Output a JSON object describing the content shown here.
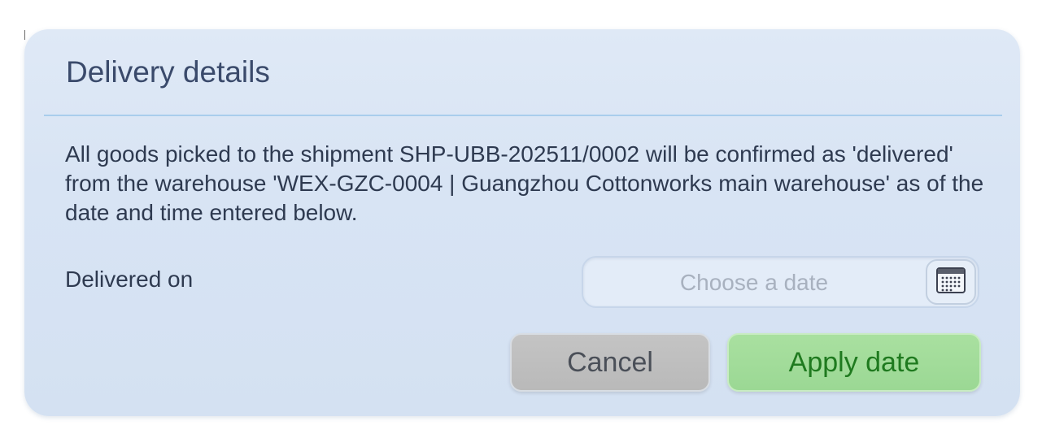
{
  "dialog": {
    "title": "Delivery details",
    "message": "All goods picked to the shipment SHP-UBB-202511/0002 will be confirmed as 'delivered' from the warehouse 'WEX-GZC-0004 | Guangzhou Cottonworks main warehouse' as of the date and time entered below.",
    "delivered_on": {
      "label": "Delivered on",
      "value": "",
      "placeholder": "Choose a date",
      "calendar_icon": "calendar-icon"
    },
    "buttons": {
      "cancel_label": "Cancel",
      "apply_label": "Apply date"
    }
  },
  "colors": {
    "dialog_background": "#d8e4f4",
    "title_text": "#3a4a6b",
    "divider": "#a9cdec",
    "cancel_background": "#bebebe",
    "apply_background": "#a2dc9a",
    "apply_text": "#1f7a1f"
  }
}
